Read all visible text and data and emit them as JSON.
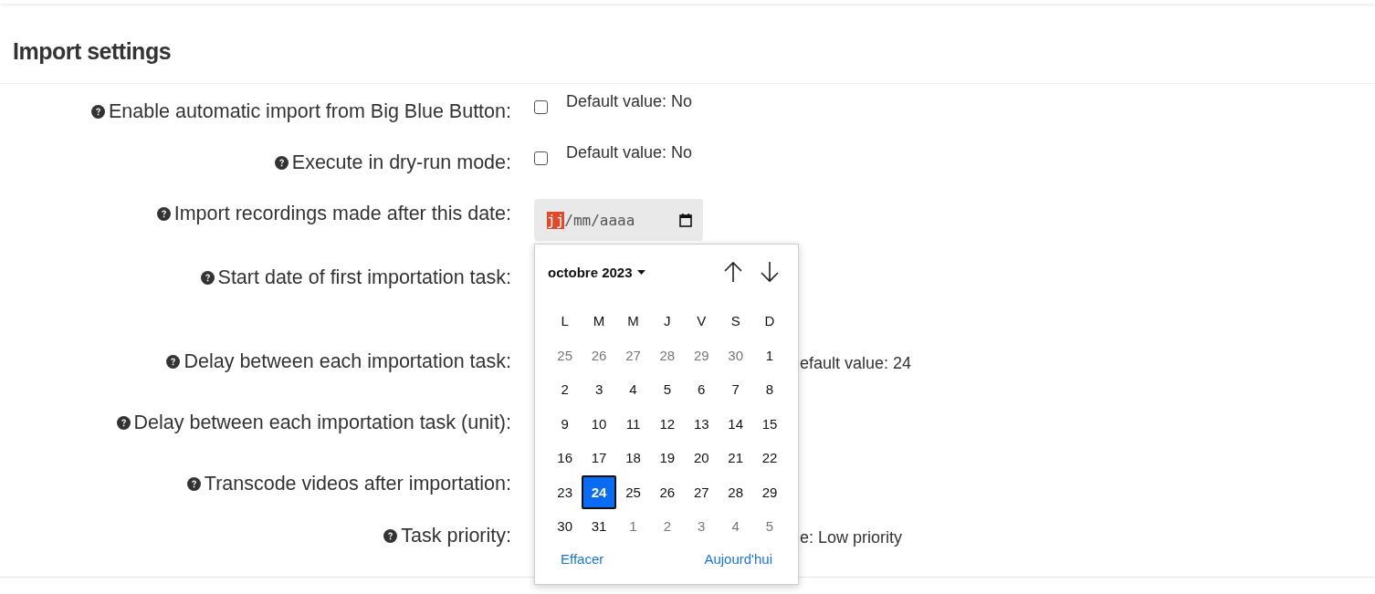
{
  "page_title": "Import settings",
  "settings": [
    {
      "kind": "checkbox",
      "label": "Enable automatic import from Big Blue Button:",
      "checked": false,
      "default_text": "Default value: No"
    },
    {
      "kind": "checkbox",
      "label": "Execute in dry-run mode:",
      "checked": false,
      "default_text": "Default value: No"
    },
    {
      "kind": "date",
      "label": "Import recordings made after this date:",
      "segments": [
        {
          "text": "jj",
          "selected": true
        },
        {
          "text": "/",
          "selected": false
        },
        {
          "text": "mm",
          "selected": false
        },
        {
          "text": "/",
          "selected": false
        },
        {
          "text": "aaaa",
          "selected": false
        }
      ]
    },
    {
      "kind": "covered",
      "label": "Start date of first importation task:"
    },
    {
      "kind": "covered",
      "label": "Delay between each importation task:",
      "default_text": "efault value: 24"
    },
    {
      "kind": "covered",
      "label": "Delay between each importation task (unit):"
    },
    {
      "kind": "covered",
      "label": "Transcode videos after importation:"
    },
    {
      "kind": "covered",
      "label": "Task priority:",
      "default_text": "e: Low priority"
    }
  ],
  "calendar": {
    "month_label": "octobre 2023",
    "weekdays": [
      "L",
      "M",
      "M",
      "J",
      "V",
      "S",
      "D"
    ],
    "weeks": [
      [
        {
          "day": "25",
          "outside": true,
          "selected": false
        },
        {
          "day": "26",
          "outside": true,
          "selected": false
        },
        {
          "day": "27",
          "outside": true,
          "selected": false
        },
        {
          "day": "28",
          "outside": true,
          "selected": false
        },
        {
          "day": "29",
          "outside": true,
          "selected": false
        },
        {
          "day": "30",
          "outside": true,
          "selected": false
        },
        {
          "day": "1",
          "outside": false,
          "selected": false
        }
      ],
      [
        {
          "day": "2",
          "outside": false,
          "selected": false
        },
        {
          "day": "3",
          "outside": false,
          "selected": false
        },
        {
          "day": "4",
          "outside": false,
          "selected": false
        },
        {
          "day": "5",
          "outside": false,
          "selected": false
        },
        {
          "day": "6",
          "outside": false,
          "selected": false
        },
        {
          "day": "7",
          "outside": false,
          "selected": false
        },
        {
          "day": "8",
          "outside": false,
          "selected": false
        }
      ],
      [
        {
          "day": "9",
          "outside": false,
          "selected": false
        },
        {
          "day": "10",
          "outside": false,
          "selected": false
        },
        {
          "day": "11",
          "outside": false,
          "selected": false
        },
        {
          "day": "12",
          "outside": false,
          "selected": false
        },
        {
          "day": "13",
          "outside": false,
          "selected": false
        },
        {
          "day": "14",
          "outside": false,
          "selected": false
        },
        {
          "day": "15",
          "outside": false,
          "selected": false
        }
      ],
      [
        {
          "day": "16",
          "outside": false,
          "selected": false
        },
        {
          "day": "17",
          "outside": false,
          "selected": false
        },
        {
          "day": "18",
          "outside": false,
          "selected": false
        },
        {
          "day": "19",
          "outside": false,
          "selected": false
        },
        {
          "day": "20",
          "outside": false,
          "selected": false
        },
        {
          "day": "21",
          "outside": false,
          "selected": false
        },
        {
          "day": "22",
          "outside": false,
          "selected": false
        }
      ],
      [
        {
          "day": "23",
          "outside": false,
          "selected": false
        },
        {
          "day": "24",
          "outside": false,
          "selected": true
        },
        {
          "day": "25",
          "outside": false,
          "selected": false
        },
        {
          "day": "26",
          "outside": false,
          "selected": false
        },
        {
          "day": "27",
          "outside": false,
          "selected": false
        },
        {
          "day": "28",
          "outside": false,
          "selected": false
        },
        {
          "day": "29",
          "outside": false,
          "selected": false
        }
      ],
      [
        {
          "day": "30",
          "outside": false,
          "selected": false
        },
        {
          "day": "31",
          "outside": false,
          "selected": false
        },
        {
          "day": "1",
          "outside": true,
          "selected": false
        },
        {
          "day": "2",
          "outside": true,
          "selected": false
        },
        {
          "day": "3",
          "outside": true,
          "selected": false
        },
        {
          "day": "4",
          "outside": true,
          "selected": false
        },
        {
          "day": "5",
          "outside": true,
          "selected": false
        }
      ]
    ],
    "buttons": [
      "Effacer",
      "Aujourd'hui"
    ]
  }
}
